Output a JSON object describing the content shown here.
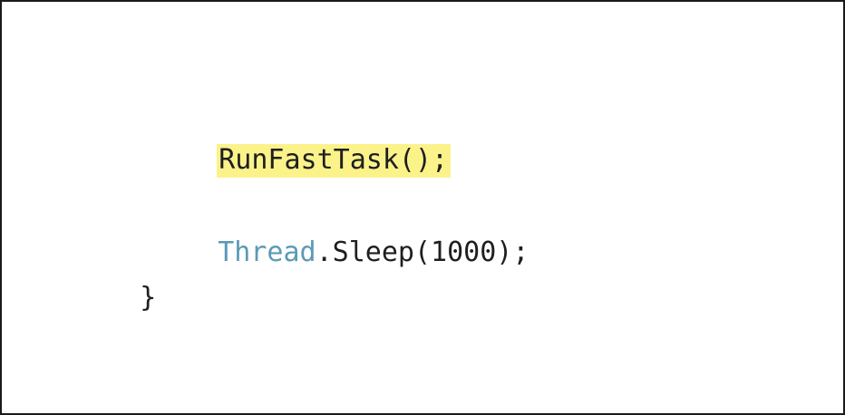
{
  "code": {
    "line1": {
      "call": "RunFastTask();"
    },
    "line2": {
      "type_name": "Thread",
      "member_call": ".Sleep(1000);"
    },
    "line3": {
      "closing_brace": "}"
    }
  },
  "colors": {
    "highlight": "#fbf38a",
    "type_name": "#5b9ab6",
    "text": "#1f1f1f"
  }
}
